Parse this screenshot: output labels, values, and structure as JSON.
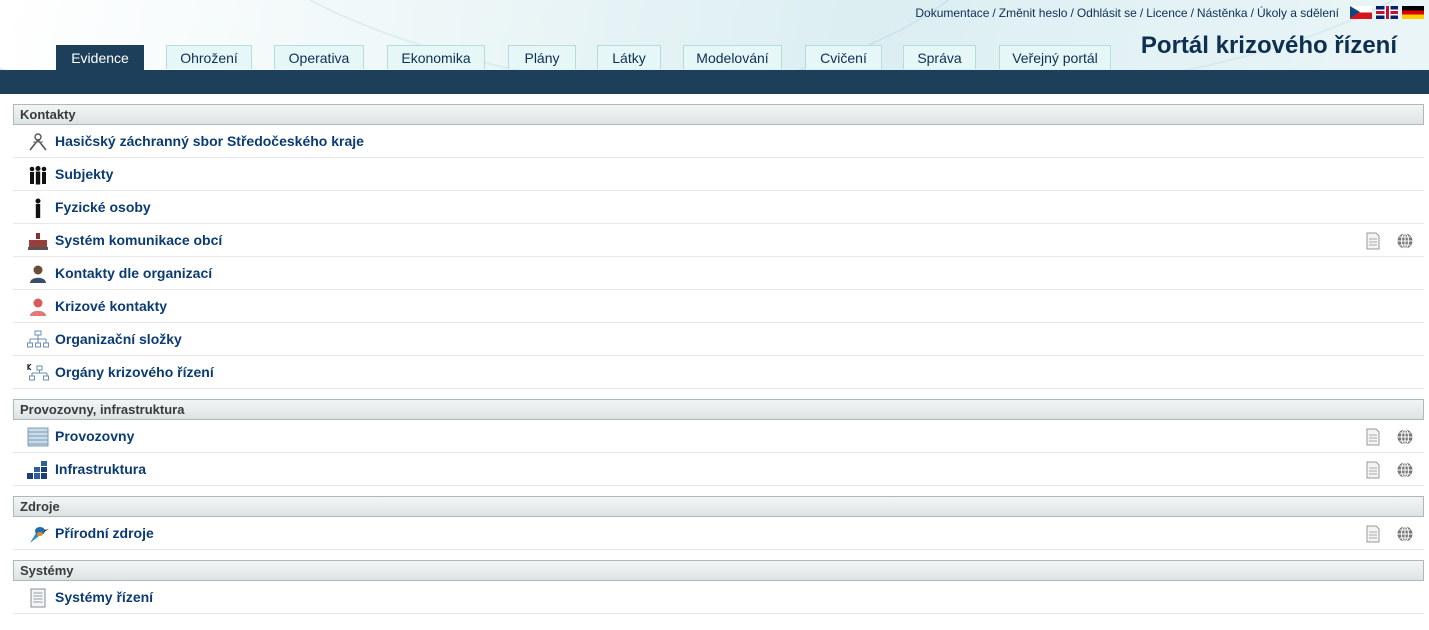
{
  "top_links": [
    {
      "label": "Dokumentace"
    },
    {
      "label": "Změnit heslo"
    },
    {
      "label": "Odhlásit se"
    },
    {
      "label": "Licence"
    },
    {
      "label": "Nástěnka"
    },
    {
      "label": "Úkoly a sdělení"
    }
  ],
  "top_link_separator": "/",
  "portal_title": "Portál krizového řízení",
  "tabs": [
    {
      "label": "Evidence"
    },
    {
      "label": "Ohrožení"
    },
    {
      "label": "Operativa"
    },
    {
      "label": "Ekonomika"
    },
    {
      "label": "Plány"
    },
    {
      "label": "Látky"
    },
    {
      "label": "Modelování"
    },
    {
      "label": "Cvičení"
    },
    {
      "label": "Správa"
    },
    {
      "label": "Veřejný portál"
    }
  ],
  "sections": [
    {
      "title": "Kontakty",
      "items": [
        {
          "label": "Hasičský záchranný sbor Středočeského kraje",
          "icon": "firefighter-emblem-icon"
        },
        {
          "label": "Subjekty",
          "icon": "people-group-icon"
        },
        {
          "label": "Fyzické osoby",
          "icon": "person-icon"
        },
        {
          "label": "Systém komunikace obcí",
          "icon": "townhall-icon"
        },
        {
          "label": "Kontakty dle organizací",
          "icon": "user-contact-icon"
        },
        {
          "label": "Krizové kontakty",
          "icon": "crisis-contact-icon"
        },
        {
          "label": "Organizační složky",
          "icon": "org-tree-icon"
        },
        {
          "label": "Orgány krizového řízení",
          "icon": "crisis-org-tree-icon"
        }
      ]
    },
    {
      "title": "Provozovny, infrastruktura",
      "items": [
        {
          "label": "Provozovny",
          "icon": "facility-icon"
        },
        {
          "label": "Infrastruktura",
          "icon": "infrastructure-icon"
        }
      ]
    },
    {
      "title": "Zdroje",
      "items": [
        {
          "label": "Přírodní zdroje",
          "icon": "kingfisher-bird-icon"
        }
      ]
    },
    {
      "title": "Systémy",
      "items": [
        {
          "label": "Systémy řízení",
          "icon": "document-list-icon"
        }
      ]
    }
  ],
  "colors": {
    "navbar": "#1d3f5a",
    "tab_inactive": "#e6f7f7",
    "link": "#0b3b73",
    "title": "#0d3050"
  }
}
